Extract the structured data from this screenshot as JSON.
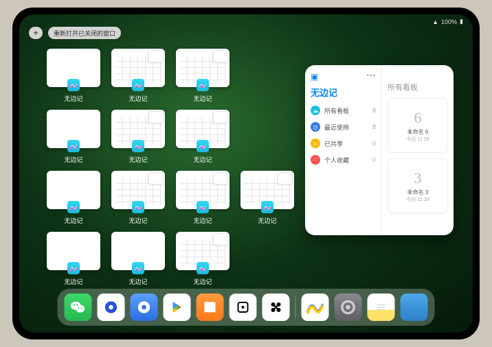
{
  "status": {
    "signal": "•••",
    "wifi": "⌵",
    "battery": "100%"
  },
  "topbar": {
    "plus": "+",
    "reopen_label": "重新打开已关闭的窗口"
  },
  "app_label": "无边记",
  "grid": [
    {
      "type": "blank",
      "row": 1,
      "col": 1
    },
    {
      "type": "cal",
      "row": 1,
      "col": 2
    },
    {
      "type": "cal",
      "row": 1,
      "col": 3
    },
    {
      "type": "blank",
      "row": 2,
      "col": 1
    },
    {
      "type": "cal",
      "row": 2,
      "col": 2
    },
    {
      "type": "cal",
      "row": 2,
      "col": 3
    },
    {
      "type": "blank",
      "row": 3,
      "col": 1
    },
    {
      "type": "cal",
      "row": 3,
      "col": 2
    },
    {
      "type": "cal",
      "row": 3,
      "col": 3
    },
    {
      "type": "cal",
      "row": 3,
      "col": 4
    },
    {
      "type": "blank",
      "row": 4,
      "col": 1
    },
    {
      "type": "blank",
      "row": 4,
      "col": 2
    },
    {
      "type": "cal",
      "row": 4,
      "col": 3
    }
  ],
  "panel": {
    "title": "无边记",
    "right_title": "所有看板",
    "items": [
      {
        "label": "所有看板",
        "count": "8",
        "color": "#1fc1e0",
        "glyph": "☁"
      },
      {
        "label": "最近使用",
        "count": "8",
        "color": "#2f7de0",
        "glyph": "◷"
      },
      {
        "label": "已共享",
        "count": "0",
        "color": "#ffb700",
        "glyph": "☺"
      },
      {
        "label": "个人收藏",
        "count": "0",
        "color": "#ff4d4d",
        "glyph": "♡"
      }
    ],
    "boards": [
      {
        "num": "6",
        "name": "未命名 6",
        "time": "今日 11:29"
      },
      {
        "num": "3",
        "name": "未命名 3",
        "time": "今日 11:29"
      }
    ]
  },
  "dock": [
    {
      "k": "wechat",
      "label": "WeChat"
    },
    {
      "k": "qhd",
      "label": "Quark HD"
    },
    {
      "k": "qc",
      "label": "Quark"
    },
    {
      "k": "play",
      "label": "Play"
    },
    {
      "k": "books",
      "label": "Books"
    },
    {
      "k": "dice",
      "label": "App"
    },
    {
      "k": "hx",
      "label": "App"
    },
    {
      "k": "sep"
    },
    {
      "k": "free",
      "label": "Freeform"
    },
    {
      "k": "gear",
      "label": "Settings"
    },
    {
      "k": "notes",
      "label": "Notes"
    },
    {
      "k": "lib",
      "label": "App Library"
    }
  ]
}
